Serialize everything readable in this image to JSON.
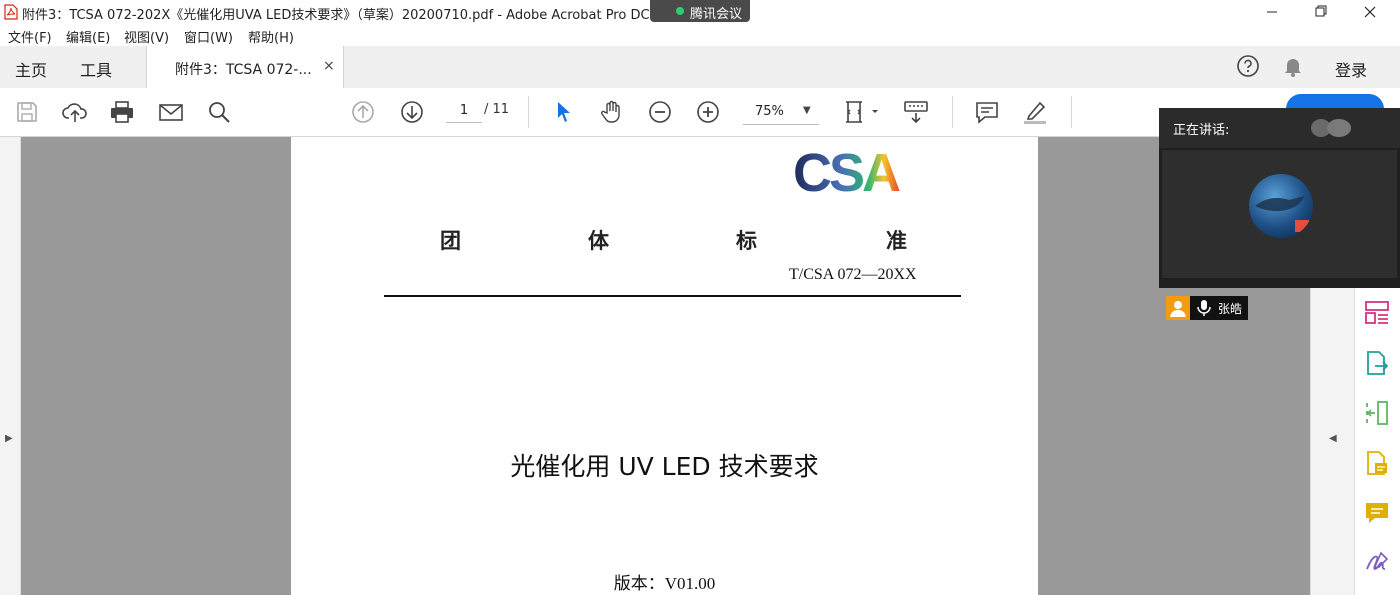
{
  "window": {
    "title": "附件3：TCSA 072-202X《光催化用UVA LED技术要求》（草案）20200710.pdf - Adobe Acrobat Pro DC",
    "meeting_pill": "腾讯会议"
  },
  "menu": [
    "文件(F)",
    "编辑(E)",
    "视图(V)",
    "窗口(W)",
    "帮助(H)"
  ],
  "tabs": {
    "home": "主页",
    "tools": "工具",
    "document": "附件3：TCSA 072-...",
    "close": "×",
    "login": "登录"
  },
  "toolbar": {
    "page_current": "1",
    "page_total": "/ 11",
    "zoom": "75%",
    "zoom_caret": "▼"
  },
  "rails": {
    "left_arrow": "▶",
    "right_arrow": "◀"
  },
  "page": {
    "logo_text": "CSA",
    "standard_chars": [
      "团",
      "体",
      "标",
      "准"
    ],
    "standard_code": "T/CSA  072—20XX",
    "title": "光催化用 UV LED 技术要求",
    "version": "版本：V01.00"
  },
  "meeting": {
    "speaking_label": "正在讲话:",
    "participant": "张皓"
  },
  "colors": {
    "acrobat_blue": "#1473e6",
    "canvas_gray": "#999999",
    "meeting_dark": "#1f1f1f"
  }
}
